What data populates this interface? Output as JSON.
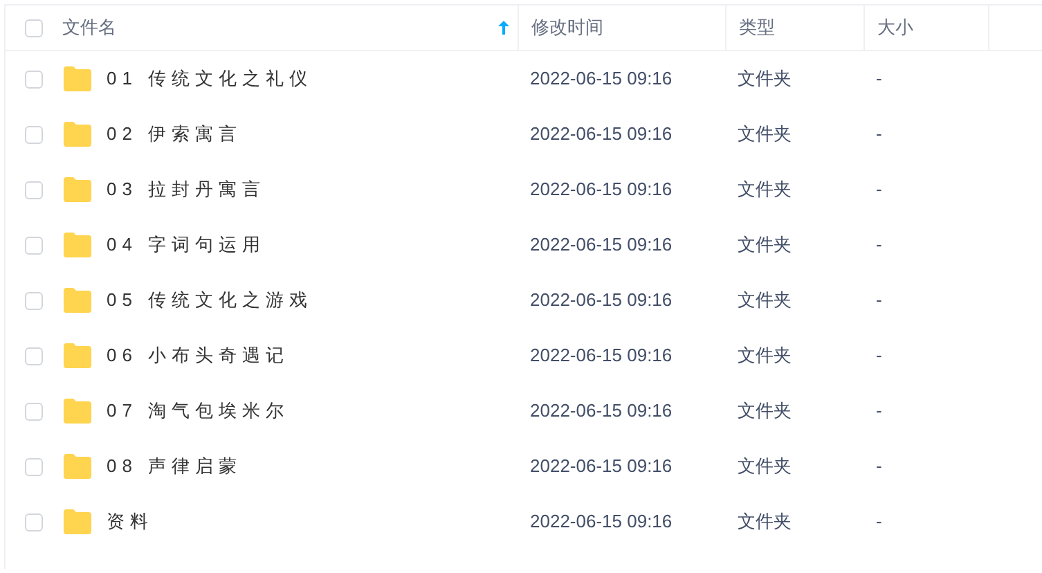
{
  "table": {
    "columns": [
      {
        "label": "文件名",
        "sorted": true
      },
      {
        "label": "修改时间",
        "sorted": false
      },
      {
        "label": "类型",
        "sorted": false
      },
      {
        "label": "大小",
        "sorted": false
      }
    ],
    "select_all": {
      "checked": false
    },
    "rows": [
      {
        "name": "01 传统文化之礼仪",
        "modified": "2022-06-15 09:16",
        "type": "文件夹",
        "size": "-",
        "checked": false
      },
      {
        "name": "02 伊索寓言",
        "modified": "2022-06-15 09:16",
        "type": "文件夹",
        "size": "-",
        "checked": false
      },
      {
        "name": "03 拉封丹寓言",
        "modified": "2022-06-15 09:16",
        "type": "文件夹",
        "size": "-",
        "checked": false
      },
      {
        "name": "04 字词句运用",
        "modified": "2022-06-15 09:16",
        "type": "文件夹",
        "size": "-",
        "checked": false
      },
      {
        "name": "05 传统文化之游戏",
        "modified": "2022-06-15 09:16",
        "type": "文件夹",
        "size": "-",
        "checked": false
      },
      {
        "name": "06 小布头奇遇记",
        "modified": "2022-06-15 09:16",
        "type": "文件夹",
        "size": "-",
        "checked": false
      },
      {
        "name": "07 淘气包埃米尔",
        "modified": "2022-06-15 09:16",
        "type": "文件夹",
        "size": "-",
        "checked": false
      },
      {
        "name": "08 声律启蒙",
        "modified": "2022-06-15 09:16",
        "type": "文件夹",
        "size": "-",
        "checked": false
      },
      {
        "name": "资料",
        "modified": "2022-06-15 09:16",
        "type": "文件夹",
        "size": "-",
        "checked": false
      }
    ]
  }
}
